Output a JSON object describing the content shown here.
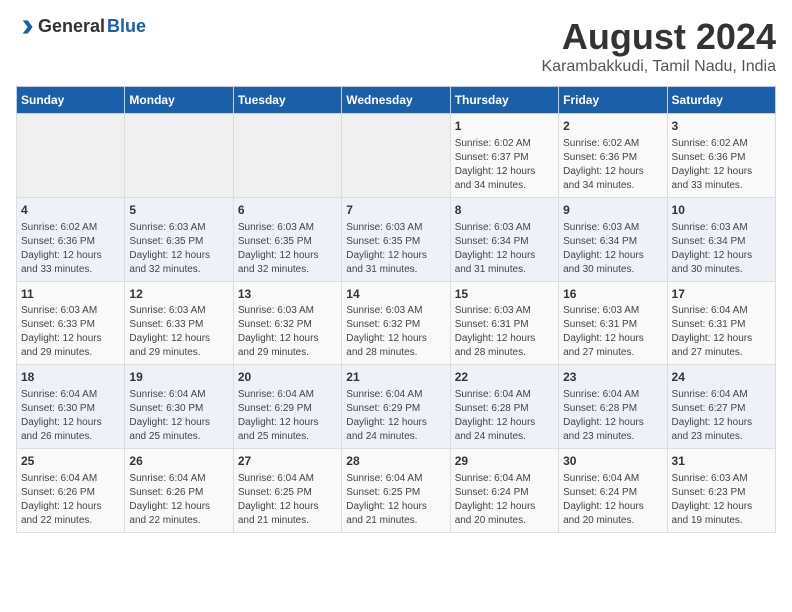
{
  "logo": {
    "general": "General",
    "blue": "Blue"
  },
  "title": "August 2024",
  "subtitle": "Karambakkudi, Tamil Nadu, India",
  "weekdays": [
    "Sunday",
    "Monday",
    "Tuesday",
    "Wednesday",
    "Thursday",
    "Friday",
    "Saturday"
  ],
  "weeks": [
    [
      {
        "day": "",
        "info": ""
      },
      {
        "day": "",
        "info": ""
      },
      {
        "day": "",
        "info": ""
      },
      {
        "day": "",
        "info": ""
      },
      {
        "day": "1",
        "info": "Sunrise: 6:02 AM\nSunset: 6:37 PM\nDaylight: 12 hours\nand 34 minutes."
      },
      {
        "day": "2",
        "info": "Sunrise: 6:02 AM\nSunset: 6:36 PM\nDaylight: 12 hours\nand 34 minutes."
      },
      {
        "day": "3",
        "info": "Sunrise: 6:02 AM\nSunset: 6:36 PM\nDaylight: 12 hours\nand 33 minutes."
      }
    ],
    [
      {
        "day": "4",
        "info": "Sunrise: 6:02 AM\nSunset: 6:36 PM\nDaylight: 12 hours\nand 33 minutes."
      },
      {
        "day": "5",
        "info": "Sunrise: 6:03 AM\nSunset: 6:35 PM\nDaylight: 12 hours\nand 32 minutes."
      },
      {
        "day": "6",
        "info": "Sunrise: 6:03 AM\nSunset: 6:35 PM\nDaylight: 12 hours\nand 32 minutes."
      },
      {
        "day": "7",
        "info": "Sunrise: 6:03 AM\nSunset: 6:35 PM\nDaylight: 12 hours\nand 31 minutes."
      },
      {
        "day": "8",
        "info": "Sunrise: 6:03 AM\nSunset: 6:34 PM\nDaylight: 12 hours\nand 31 minutes."
      },
      {
        "day": "9",
        "info": "Sunrise: 6:03 AM\nSunset: 6:34 PM\nDaylight: 12 hours\nand 30 minutes."
      },
      {
        "day": "10",
        "info": "Sunrise: 6:03 AM\nSunset: 6:34 PM\nDaylight: 12 hours\nand 30 minutes."
      }
    ],
    [
      {
        "day": "11",
        "info": "Sunrise: 6:03 AM\nSunset: 6:33 PM\nDaylight: 12 hours\nand 29 minutes."
      },
      {
        "day": "12",
        "info": "Sunrise: 6:03 AM\nSunset: 6:33 PM\nDaylight: 12 hours\nand 29 minutes."
      },
      {
        "day": "13",
        "info": "Sunrise: 6:03 AM\nSunset: 6:32 PM\nDaylight: 12 hours\nand 29 minutes."
      },
      {
        "day": "14",
        "info": "Sunrise: 6:03 AM\nSunset: 6:32 PM\nDaylight: 12 hours\nand 28 minutes."
      },
      {
        "day": "15",
        "info": "Sunrise: 6:03 AM\nSunset: 6:31 PM\nDaylight: 12 hours\nand 28 minutes."
      },
      {
        "day": "16",
        "info": "Sunrise: 6:03 AM\nSunset: 6:31 PM\nDaylight: 12 hours\nand 27 minutes."
      },
      {
        "day": "17",
        "info": "Sunrise: 6:04 AM\nSunset: 6:31 PM\nDaylight: 12 hours\nand 27 minutes."
      }
    ],
    [
      {
        "day": "18",
        "info": "Sunrise: 6:04 AM\nSunset: 6:30 PM\nDaylight: 12 hours\nand 26 minutes."
      },
      {
        "day": "19",
        "info": "Sunrise: 6:04 AM\nSunset: 6:30 PM\nDaylight: 12 hours\nand 25 minutes."
      },
      {
        "day": "20",
        "info": "Sunrise: 6:04 AM\nSunset: 6:29 PM\nDaylight: 12 hours\nand 25 minutes."
      },
      {
        "day": "21",
        "info": "Sunrise: 6:04 AM\nSunset: 6:29 PM\nDaylight: 12 hours\nand 24 minutes."
      },
      {
        "day": "22",
        "info": "Sunrise: 6:04 AM\nSunset: 6:28 PM\nDaylight: 12 hours\nand 24 minutes."
      },
      {
        "day": "23",
        "info": "Sunrise: 6:04 AM\nSunset: 6:28 PM\nDaylight: 12 hours\nand 23 minutes."
      },
      {
        "day": "24",
        "info": "Sunrise: 6:04 AM\nSunset: 6:27 PM\nDaylight: 12 hours\nand 23 minutes."
      }
    ],
    [
      {
        "day": "25",
        "info": "Sunrise: 6:04 AM\nSunset: 6:26 PM\nDaylight: 12 hours\nand 22 minutes."
      },
      {
        "day": "26",
        "info": "Sunrise: 6:04 AM\nSunset: 6:26 PM\nDaylight: 12 hours\nand 22 minutes."
      },
      {
        "day": "27",
        "info": "Sunrise: 6:04 AM\nSunset: 6:25 PM\nDaylight: 12 hours\nand 21 minutes."
      },
      {
        "day": "28",
        "info": "Sunrise: 6:04 AM\nSunset: 6:25 PM\nDaylight: 12 hours\nand 21 minutes."
      },
      {
        "day": "29",
        "info": "Sunrise: 6:04 AM\nSunset: 6:24 PM\nDaylight: 12 hours\nand 20 minutes."
      },
      {
        "day": "30",
        "info": "Sunrise: 6:04 AM\nSunset: 6:24 PM\nDaylight: 12 hours\nand 20 minutes."
      },
      {
        "day": "31",
        "info": "Sunrise: 6:03 AM\nSunset: 6:23 PM\nDaylight: 12 hours\nand 19 minutes."
      }
    ]
  ]
}
